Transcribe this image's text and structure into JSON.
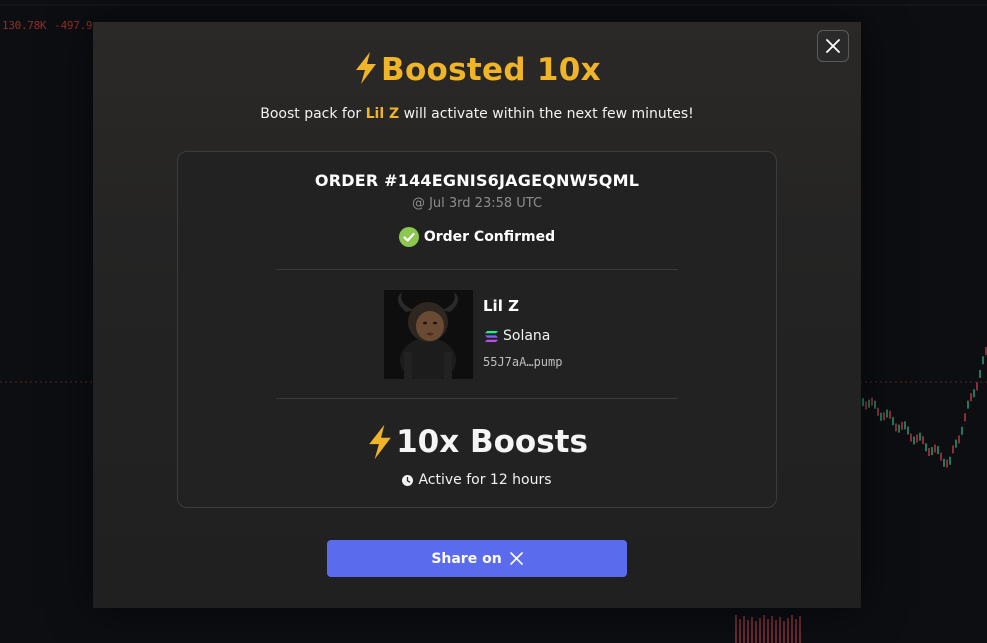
{
  "background": {
    "ticker": [
      "130.78K",
      "-497.9"
    ]
  },
  "modal": {
    "title": "Boosted 10x",
    "subtitle_prefix": "Boost pack for ",
    "subtitle_token": "Lil Z",
    "subtitle_suffix": " will activate within the next few minutes!",
    "close_icon": "close-icon",
    "accent_color": "#f0b429",
    "order": {
      "id": "ORDER #144EGNIS6JAGEQNW5QML",
      "timestamp": "@ Jul 3rd 23:58 UTC",
      "status": "Order Confirmed",
      "status_color": "#8cc751"
    },
    "token": {
      "name": "Lil Z",
      "chain": "Solana",
      "address": "55J7aA…pump"
    },
    "boosts": {
      "label": "10x Boosts",
      "duration": "Active for 12 hours"
    },
    "share": {
      "label": "Share on",
      "icon": "x-logo-icon",
      "color": "#5b6bee"
    }
  }
}
